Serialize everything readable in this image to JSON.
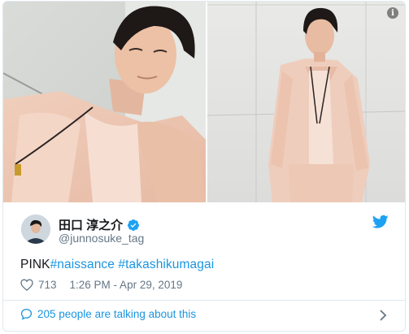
{
  "colors": {
    "link": "#1b95e0",
    "secondary_text": "#657786",
    "border": "#e1e8ed",
    "jacket": "#efcbb7"
  },
  "media": {
    "photos": [
      {
        "subject": "selfie-man-pink-jacket"
      },
      {
        "subject": "standing-man-pink-suit"
      }
    ],
    "info_icon": "info-icon"
  },
  "author": {
    "display_name": "田口 淳之介",
    "handle": "@junnosuke_tag",
    "verified_icon": "verified-badge-icon",
    "brand_icon": "twitter-bird-icon"
  },
  "tweet": {
    "text_plain": "PINK",
    "hashtags": [
      "#naissance",
      "#takashikumagai"
    ]
  },
  "meta": {
    "like_count": "713",
    "timestamp": "1:26 PM - Apr 29, 2019"
  },
  "footer": {
    "talking_text": "205 people are talking about this"
  }
}
